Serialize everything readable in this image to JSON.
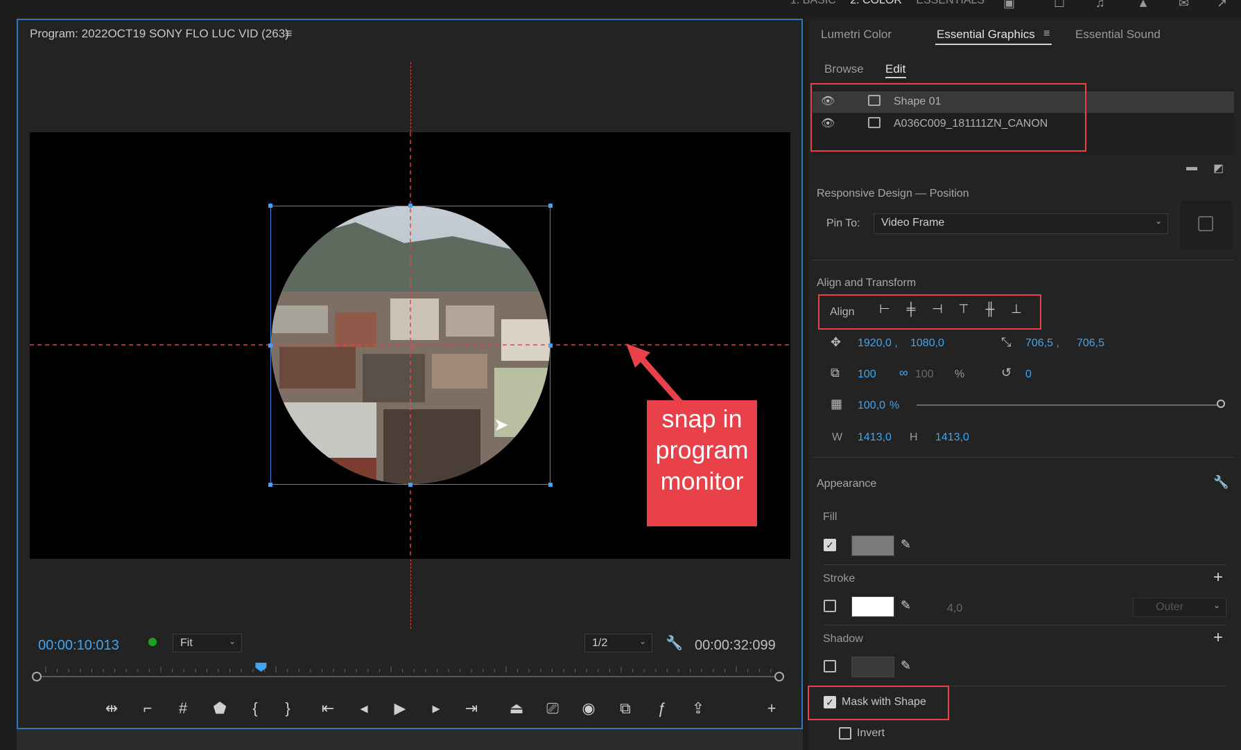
{
  "workspace_tabs": [
    "1. BASIC",
    "2. COLOR",
    "ESSENTIALS"
  ],
  "workspace_active": "2. COLOR",
  "program": {
    "title": "Program: 2022OCT19 SONY FLO LUC VID (263)",
    "menu_icon": "hamburger-icon",
    "timecode_current": "00:00:10:013",
    "fit_label": "Fit",
    "resolution_label": "1/2",
    "timecode_duration": "00:00:32:099",
    "playhead_fraction": 0.302,
    "annotation": "snap in program monitor",
    "annotation_lines": [
      "snap in",
      "program",
      "monitor"
    ],
    "annotation_color": "#e8414a"
  },
  "transport_buttons": [
    "mark-in-out-icon",
    "lift-icon",
    "safe-margins-icon",
    "add-marker-icon",
    "mark-in-icon",
    "mark-out-icon",
    "go-to-in-icon",
    "step-back-icon",
    "play-icon",
    "step-forward-icon",
    "go-to-out-icon",
    "lift-extract-icon",
    "extract-icon",
    "export-frame-icon",
    "comparison-view-icon",
    "fx-icon",
    "share-icon",
    "add-button-icon"
  ],
  "panel_tabs": {
    "lumetri": "Lumetri Color",
    "essential_graphics": "Essential Graphics",
    "essential_sound": "Essential Sound"
  },
  "subtabs": {
    "browse": "Browse",
    "edit": "Edit"
  },
  "layers": [
    {
      "name": "Shape 01",
      "icon": "shape-layer-icon",
      "selected": true
    },
    {
      "name": "A036C009_181111ZN_CANON",
      "icon": "clip-layer-icon",
      "selected": false
    }
  ],
  "responsive": {
    "title": "Responsive Design — Position",
    "pin_label": "Pin To:",
    "pin_value": "Video Frame"
  },
  "align_transform": {
    "title": "Align and Transform",
    "align_label": "Align",
    "position_x": "1920,0 ,",
    "position_y": "1080,0",
    "anchor_x": "706,5 ,",
    "anchor_y": "706,5",
    "scale": "100",
    "scale_linked": "100",
    "scale_unit": "%",
    "rotation": "0",
    "opacity": "100,0",
    "opacity_unit": "%",
    "width_label": "W",
    "width": "1413,0",
    "height_label": "H",
    "height": "1413,0"
  },
  "appearance": {
    "title": "Appearance",
    "fill_label": "Fill",
    "fill_checked": true,
    "fill_color": "#7a7a7a",
    "stroke_label": "Stroke",
    "stroke_checked": false,
    "stroke_color": "#ffffff",
    "stroke_width": "4,0",
    "stroke_type": "Outer",
    "shadow_label": "Shadow",
    "shadow_checked": false,
    "mask_label": "Mask with Shape",
    "mask_checked": true,
    "invert_label": "Invert",
    "invert_checked": false
  },
  "colors": {
    "accent": "#3ea6f2",
    "highlight_box": "#e8414a",
    "panel_border": "#2c79c0"
  }
}
